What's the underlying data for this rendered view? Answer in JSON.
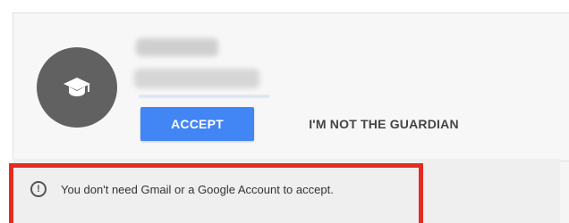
{
  "profile": {
    "avatar_icon": "graduation-cap-icon"
  },
  "actions": {
    "accept_label": "ACCEPT",
    "not_guardian_label": "I'M NOT THE GUARDIAN"
  },
  "notice": {
    "icon": "exclamation-circle-icon",
    "text": "You don't need Gmail or a Google Account to accept."
  },
  "colors": {
    "accent": "#4285f4",
    "highlight": "#e52b21",
    "avatar": "#616161"
  }
}
